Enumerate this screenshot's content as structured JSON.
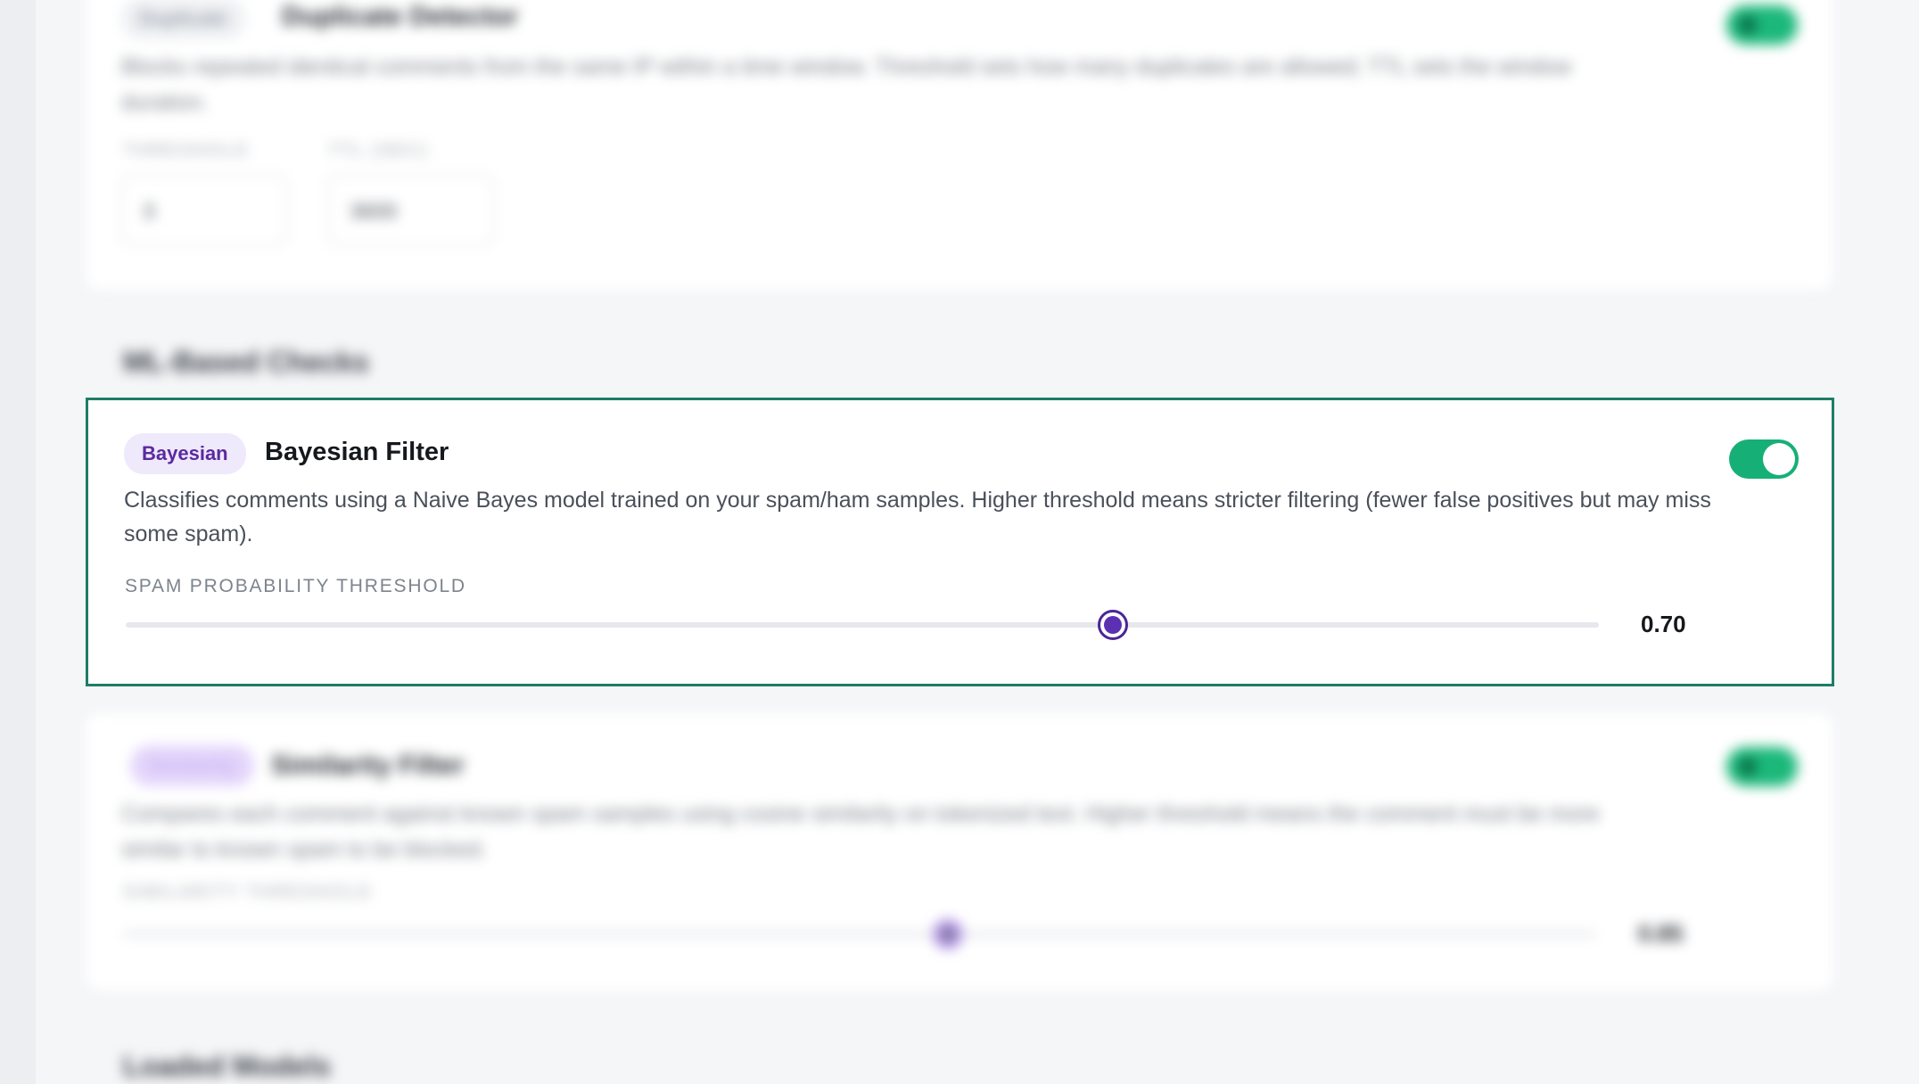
{
  "duplicate_card": {
    "badge": "Duplicate",
    "title": "Duplicate Detector",
    "description": "Blocks repeated identical comments from the same IP within a time window. Threshold sets how many duplicates are allowed; TTL sets the window duration.",
    "threshold_label": "THRESHOLD",
    "threshold_value": "3",
    "ttl_label": "TTL (SEC)",
    "ttl_value": "3600",
    "enabled": true
  },
  "ml_section": {
    "heading": "ML-Based Checks"
  },
  "bayesian_card": {
    "badge": "Bayesian",
    "title": "Bayesian Filter",
    "description": "Classifies comments using a Naive Bayes model trained on your spam/ham samples. Higher threshold means stricter filtering (fewer false positives but may miss some spam).",
    "slider_label": "SPAM PROBABILITY THRESHOLD",
    "slider_value": "0.70",
    "slider_fraction": 0.67,
    "enabled": true
  },
  "similarity_card": {
    "badge": "Similarity",
    "title": "Similarity Filter",
    "description": "Compares each comment against known spam samples using cosine similarity on tokenized text. Higher threshold means the comment must be more similar to known spam to be blocked.",
    "slider_label": "SIMILARITY THRESHOLD",
    "slider_value": "0.85",
    "slider_fraction": 0.56,
    "enabled": true
  },
  "models_section": {
    "heading": "Loaded Models"
  },
  "colors": {
    "accent_purple": "#5b30b2",
    "toggle_green": "#16b077",
    "focus_border": "#1d7e66"
  }
}
